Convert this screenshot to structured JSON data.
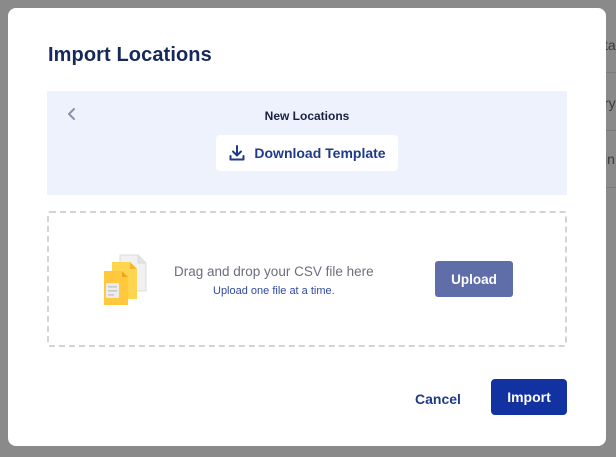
{
  "background": {
    "fragments": [
      "ta",
      "ry",
      "in"
    ]
  },
  "modal": {
    "title": "Import Locations",
    "template_panel": {
      "back_icon": "chevron-left-icon",
      "heading": "New Locations",
      "download_label": "Download Template",
      "download_icon": "download-icon"
    },
    "dropzone": {
      "icon": "file-stack-icon",
      "main_text": "Drag and drop your CSV file here",
      "sub_text": "Upload one file at a time.",
      "upload_label": "Upload"
    },
    "footer": {
      "cancel_label": "Cancel",
      "import_label": "Import"
    }
  },
  "colors": {
    "title": "#16295a",
    "accent": "#1332a1",
    "link": "#1f3a8a",
    "panel_bg": "#eef2fd",
    "upload_bg": "#5f6ea8"
  }
}
